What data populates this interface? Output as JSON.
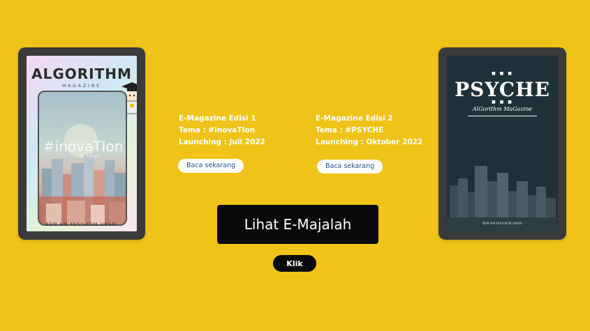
{
  "editions": [
    {
      "cover": {
        "title": "ALGORITHM",
        "subtitle": "MAGAZINE",
        "hashtag": "#inovaTIon",
        "edition": "1st Edition",
        "footer": "BEM KM FASILKOM UNSRI"
      },
      "line1": "E-Magazine  Edisi 1",
      "line2": "Tema : #inovaTIon",
      "line3": "Launching : Juli 2022",
      "button": "Baca sekarang"
    },
    {
      "cover": {
        "title": "PSYCHE",
        "subtitle": "AlGorithm MaGazine",
        "footer": "BEM KM FASILKOM UNSRI"
      },
      "line1": "E-Magazine Edisi 2",
      "line2": "Tema : #PSYCHE",
      "line3": "Launching : Oktober 2022",
      "button": "Baca sekarang"
    }
  ],
  "cta": {
    "label": "Lihat E-Majalah"
  },
  "klik": {
    "label": "Klik"
  },
  "colors": {
    "background": "#efc318",
    "button_dark": "#0a0a0a",
    "pill_text": "#1a4f8f",
    "psyche_bg": "#1f3138"
  }
}
